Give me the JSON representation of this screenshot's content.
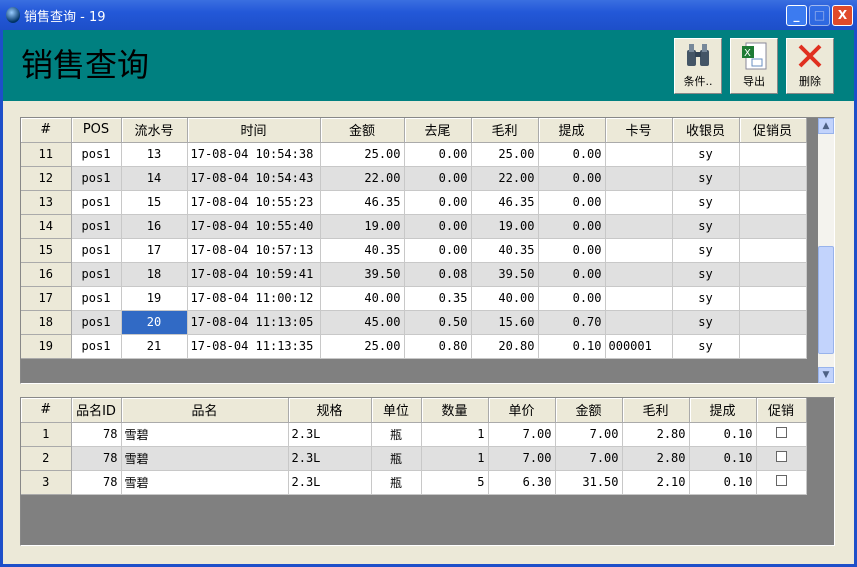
{
  "window": {
    "title": "销售查询 - 19",
    "minimize": "_",
    "maximize": "□",
    "close": "X"
  },
  "header": {
    "title": "销售查询",
    "buttons": [
      {
        "label": "条件..",
        "icon": "binoculars-icon"
      },
      {
        "label": "导出",
        "icon": "excel-icon"
      },
      {
        "label": "删除",
        "icon": "delete-x-icon"
      }
    ]
  },
  "sales": {
    "columns": [
      "#",
      "POS",
      "流水号",
      "时间",
      "金额",
      "去尾",
      "毛利",
      "提成",
      "卡号",
      "收银员",
      "促销员"
    ],
    "rows": [
      [
        "11",
        "pos1",
        "13",
        "17-08-04 10:54:38",
        "25.00",
        "0.00",
        "25.00",
        "0.00",
        "",
        "sy",
        ""
      ],
      [
        "12",
        "pos1",
        "14",
        "17-08-04 10:54:43",
        "22.00",
        "0.00",
        "22.00",
        "0.00",
        "",
        "sy",
        ""
      ],
      [
        "13",
        "pos1",
        "15",
        "17-08-04 10:55:23",
        "46.35",
        "0.00",
        "46.35",
        "0.00",
        "",
        "sy",
        ""
      ],
      [
        "14",
        "pos1",
        "16",
        "17-08-04 10:55:40",
        "19.00",
        "0.00",
        "19.00",
        "0.00",
        "",
        "sy",
        ""
      ],
      [
        "15",
        "pos1",
        "17",
        "17-08-04 10:57:13",
        "40.35",
        "0.00",
        "40.35",
        "0.00",
        "",
        "sy",
        ""
      ],
      [
        "16",
        "pos1",
        "18",
        "17-08-04 10:59:41",
        "39.50",
        "0.08",
        "39.50",
        "0.00",
        "",
        "sy",
        ""
      ],
      [
        "17",
        "pos1",
        "19",
        "17-08-04 11:00:12",
        "40.00",
        "0.35",
        "40.00",
        "0.00",
        "",
        "sy",
        ""
      ],
      [
        "18",
        "pos1",
        "20",
        "17-08-04 11:13:05",
        "45.00",
        "0.50",
        "15.60",
        "0.70",
        "",
        "sy",
        ""
      ],
      [
        "19",
        "pos1",
        "21",
        "17-08-04 11:13:35",
        "25.00",
        "0.80",
        "20.80",
        "0.10",
        "000001",
        "sy",
        ""
      ]
    ],
    "scroll_position": 0.75
  },
  "details": {
    "columns": [
      "#",
      "品名ID",
      "品名",
      "规格",
      "单位",
      "数量",
      "单价",
      "金额",
      "毛利",
      "提成",
      "促销"
    ],
    "rows": [
      [
        "1",
        "78",
        "雪碧",
        "2.3L",
        "瓶",
        "1",
        "7.00",
        "7.00",
        "2.80",
        "0.10",
        false
      ],
      [
        "2",
        "78",
        "雪碧",
        "2.3L",
        "瓶",
        "1",
        "7.00",
        "7.00",
        "2.80",
        "0.10",
        false
      ],
      [
        "3",
        "78",
        "雪碧",
        "2.3L",
        "瓶",
        "5",
        "6.30",
        "31.50",
        "2.10",
        "0.10",
        false
      ]
    ]
  }
}
